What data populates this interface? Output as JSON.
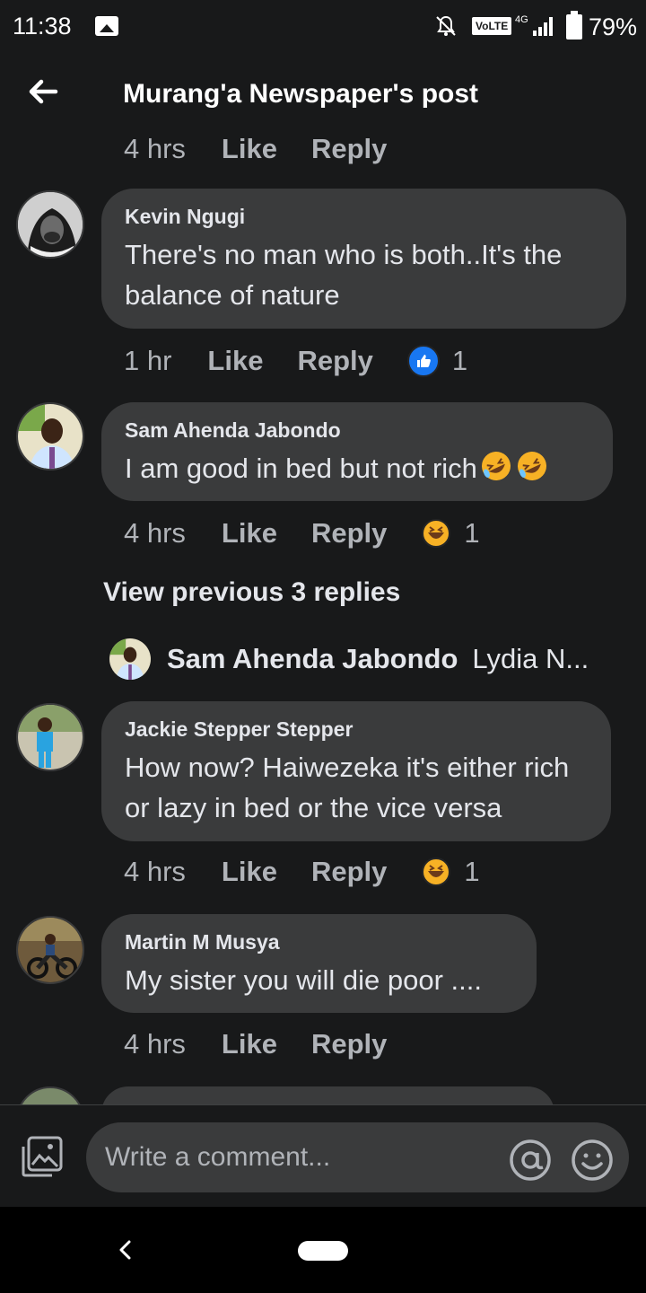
{
  "status": {
    "time": "11:38",
    "volte": "VoLTE",
    "network": "4G",
    "battery": "79%"
  },
  "header": {
    "title": "Murang'a Newspaper's post"
  },
  "actions": {
    "like": "Like",
    "reply": "Reply"
  },
  "top_meta": {
    "time": "4 hrs"
  },
  "comments": [
    {
      "name": "Kevin Ngugi",
      "text": "There's no man who is both..It's the balance of nature",
      "time": "1 hr",
      "reaction": "like",
      "reaction_count": "1"
    },
    {
      "name": "Sam Ahenda Jabondo",
      "text": "I am good in bed but not rich",
      "time": "4 hrs",
      "reaction": "haha",
      "reaction_count": "1"
    },
    {
      "name": "Jackie Stepper Stepper",
      "text": "How now? Haiwezeka it's either rich or lazy in bed or the vice versa",
      "time": "4 hrs",
      "reaction": "haha",
      "reaction_count": "1"
    },
    {
      "name": "Martin M Musya",
      "text": "My sister you will die poor ....",
      "time": "4 hrs"
    }
  ],
  "view_previous": "View previous 3 replies",
  "reply_preview": {
    "name": "Sam Ahenda Jabondo",
    "text": "Lydia N..."
  },
  "composer": {
    "placeholder": "Write a comment..."
  },
  "icons": {
    "back": "arrow-left-icon",
    "photo": "photo-icon",
    "mention": "at-icon",
    "emoji": "smiley-icon",
    "like": "thumbs-up-icon",
    "haha": "laughing-icon",
    "rofl": "rofl-emoji"
  },
  "colors": {
    "background": "#18191a",
    "bubble": "#3a3b3c",
    "like_blue": "#1877f2",
    "haha_yellow": "#f7b125"
  }
}
